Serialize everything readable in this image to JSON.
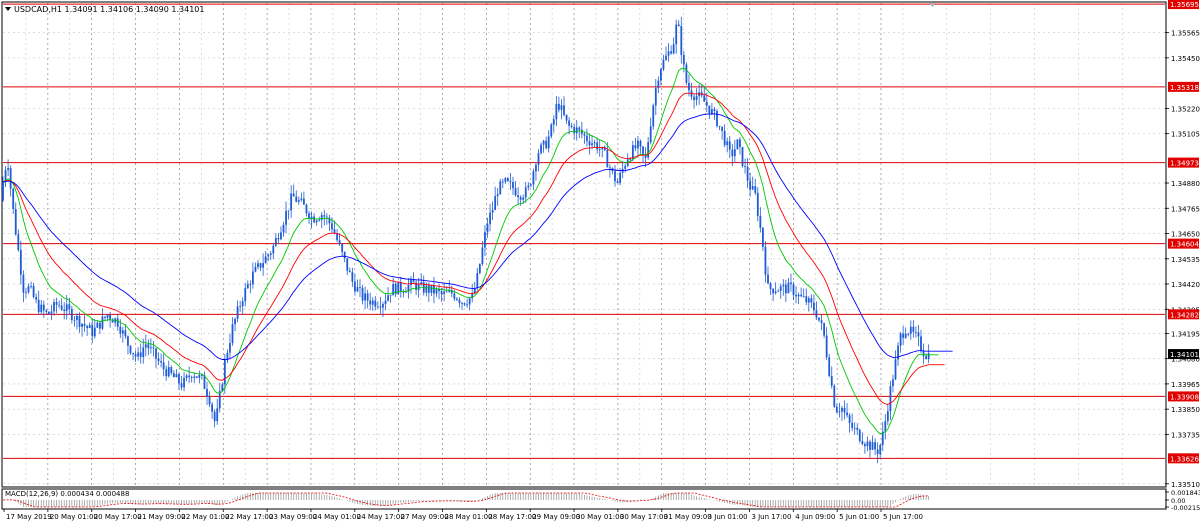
{
  "chart_data": {
    "type": "candlestick",
    "title": "USDCAD,H1  1.34091 1.34106 1.34090 1.34101",
    "grid": true,
    "main_ylim": [
      1.335,
      1.357
    ],
    "price_ticks": [
      "1.35565",
      "1.35450",
      "1.35220",
      "1.35105",
      "1.34880",
      "1.34765",
      "1.34650",
      "1.34535",
      "1.34420",
      "1.34305",
      "1.34195",
      "1.34080",
      "1.33965",
      "1.33850",
      "1.33735",
      "1.33510"
    ],
    "x_tick_labels": [
      "17 May 2019",
      "20 May 01:00",
      "20 May 17:00",
      "21 May 09:00",
      "22 May 01:00",
      "22 May 17:00",
      "23 May 09:00",
      "24 May 01:00",
      "24 May 17:00",
      "27 May 09:00",
      "28 May 01:00",
      "28 May 17:00",
      "29 May 09:00",
      "30 May 01:00",
      "30 May 17:00",
      "31 May 09:00",
      "3 Jun 01:00",
      "3 Jun 17:00",
      "4 Jun 09:00",
      "5 Jun 01:00",
      "5 Jun 17:00"
    ],
    "horizontal_levels": [
      {
        "label": "1.35695",
        "value": 1.35695
      },
      {
        "label": "1.35318",
        "value": 1.35318
      },
      {
        "label": "1.34973",
        "value": 1.34973
      },
      {
        "label": "1.34604",
        "value": 1.34604
      },
      {
        "label": "1.34282",
        "value": 1.34282
      },
      {
        "label": "1.33908",
        "value": 1.33908
      },
      {
        "label": "1.33626",
        "value": 1.33626
      }
    ],
    "current_price": {
      "label": "1.34101",
      "value": 1.34101
    },
    "price_path": [
      [
        0,
        1.347
      ],
      [
        6,
        1.349
      ],
      [
        10,
        1.35
      ],
      [
        15,
        1.3478
      ],
      [
        20,
        1.346
      ],
      [
        26,
        1.344
      ],
      [
        32,
        1.344
      ],
      [
        40,
        1.3432
      ],
      [
        50,
        1.3428
      ],
      [
        60,
        1.3433
      ],
      [
        70,
        1.343
      ],
      [
        80,
        1.3426
      ],
      [
        95,
        1.342
      ],
      [
        110,
        1.3428
      ],
      [
        120,
        1.3425
      ],
      [
        130,
        1.3415
      ],
      [
        140,
        1.3408
      ],
      [
        148,
        1.3415
      ],
      [
        156,
        1.341
      ],
      [
        165,
        1.3404
      ],
      [
        175,
        1.34
      ],
      [
        185,
        1.3396
      ],
      [
        195,
        1.3402
      ],
      [
        205,
        1.3398
      ],
      [
        212,
        1.339
      ],
      [
        218,
        1.3378
      ],
      [
        222,
        1.339
      ],
      [
        228,
        1.3408
      ],
      [
        235,
        1.3422
      ],
      [
        245,
        1.3436
      ],
      [
        255,
        1.3446
      ],
      [
        265,
        1.3452
      ],
      [
        275,
        1.3458
      ],
      [
        285,
        1.347
      ],
      [
        295,
        1.3482
      ],
      [
        305,
        1.3478
      ],
      [
        315,
        1.3472
      ],
      [
        325,
        1.3474
      ],
      [
        335,
        1.3468
      ],
      [
        345,
        1.3455
      ],
      [
        355,
        1.3443
      ],
      [
        365,
        1.3436
      ],
      [
        375,
        1.3434
      ],
      [
        385,
        1.3434
      ],
      [
        395,
        1.344
      ],
      [
        405,
        1.344
      ],
      [
        415,
        1.3442
      ],
      [
        425,
        1.344
      ],
      [
        435,
        1.3439
      ],
      [
        445,
        1.3437
      ],
      [
        455,
        1.3438
      ],
      [
        465,
        1.3434
      ],
      [
        475,
        1.3436
      ],
      [
        480,
        1.3445
      ],
      [
        485,
        1.3458
      ],
      [
        490,
        1.347
      ],
      [
        495,
        1.3476
      ],
      [
        500,
        1.3485
      ],
      [
        508,
        1.3488
      ],
      [
        515,
        1.3486
      ],
      [
        522,
        1.3483
      ],
      [
        530,
        1.3484
      ],
      [
        535,
        1.3492
      ],
      [
        540,
        1.3502
      ],
      [
        545,
        1.3504
      ],
      [
        550,
        1.3507
      ],
      [
        555,
        1.3514
      ],
      [
        560,
        1.3525
      ],
      [
        565,
        1.352
      ],
      [
        570,
        1.3514
      ],
      [
        580,
        1.3512
      ],
      [
        590,
        1.3508
      ],
      [
        600,
        1.3505
      ],
      [
        608,
        1.35
      ],
      [
        615,
        1.3492
      ],
      [
        620,
        1.3488
      ],
      [
        625,
        1.3494
      ],
      [
        630,
        1.35
      ],
      [
        640,
        1.3505
      ],
      [
        648,
        1.3498
      ],
      [
        652,
        1.3512
      ],
      [
        657,
        1.3528
      ],
      [
        662,
        1.354
      ],
      [
        667,
        1.3544
      ],
      [
        672,
        1.3548
      ],
      [
        676,
        1.3552
      ],
      [
        680,
        1.3562
      ],
      [
        684,
        1.3548
      ],
      [
        688,
        1.3535
      ],
      [
        692,
        1.353
      ],
      [
        698,
        1.3528
      ],
      [
        705,
        1.3526
      ],
      [
        712,
        1.3522
      ],
      [
        720,
        1.3516
      ],
      [
        727,
        1.3508
      ],
      [
        733,
        1.35
      ],
      [
        740,
        1.3506
      ],
      [
        745,
        1.3498
      ],
      [
        752,
        1.3487
      ],
      [
        758,
        1.3482
      ],
      [
        762,
        1.347
      ],
      [
        766,
        1.3458
      ],
      [
        770,
        1.344
      ],
      [
        778,
        1.344
      ],
      [
        786,
        1.344
      ],
      [
        794,
        1.344
      ],
      [
        802,
        1.3436
      ],
      [
        810,
        1.3434
      ],
      [
        818,
        1.343
      ],
      [
        826,
        1.342
      ],
      [
        832,
        1.3402
      ],
      [
        838,
        1.3385
      ],
      [
        844,
        1.3386
      ],
      [
        852,
        1.3378
      ],
      [
        860,
        1.3374
      ],
      [
        868,
        1.337
      ],
      [
        874,
        1.3368
      ],
      [
        880,
        1.3366
      ],
      [
        884,
        1.337
      ],
      [
        888,
        1.338
      ],
      [
        893,
        1.3394
      ],
      [
        898,
        1.3406
      ],
      [
        903,
        1.3418
      ],
      [
        908,
        1.3422
      ],
      [
        913,
        1.342
      ],
      [
        918,
        1.3418
      ],
      [
        922,
        1.3415
      ],
      [
        925,
        1.3412
      ],
      [
        928,
        1.341
      ]
    ],
    "moving_averages": [
      {
        "color": "#00c800",
        "period": "fast"
      },
      {
        "color": "#ff0000",
        "period": "medium"
      },
      {
        "color": "#0000ff",
        "period": "slow"
      }
    ],
    "indicator": {
      "label": "MACD(12,26,9) 0.000434 0.000488",
      "ticks": [
        "0.001843",
        "0.00",
        "-0.002154"
      ],
      "ylim": [
        -0.002154,
        0.001843
      ]
    },
    "colors": {
      "candles": "#1e5bd6",
      "levels": "#e00000",
      "grid": "#c8c8c8",
      "current_price_bg": "#000000",
      "level_label_bg": "#e00000",
      "macd_hist": "#9a9a9a",
      "macd_signal": "#e00000"
    }
  }
}
